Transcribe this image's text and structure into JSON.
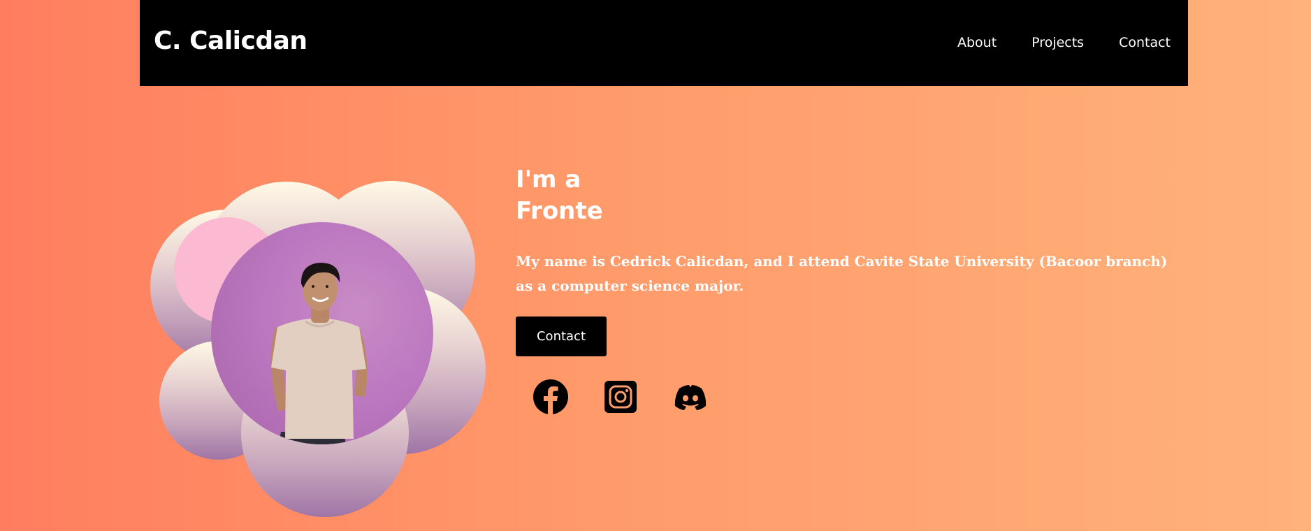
{
  "header": {
    "brand": "C. Calicdan",
    "nav": {
      "about": "About",
      "projects": "Projects",
      "contact": "Contact"
    }
  },
  "hero": {
    "heading_line1": "I'm a",
    "heading_line2": "Fronte",
    "description": "My name is Cedrick Calicdan, and I attend Cavite State University (Bacoor branch) as a computer science major.",
    "contact_button": "Contact"
  },
  "social": [
    {
      "icon": "facebook-icon"
    },
    {
      "icon": "instagram-icon"
    },
    {
      "icon": "discord-icon"
    }
  ],
  "colors": {
    "background_start": "#ff7e5f",
    "background_end": "#ffb27a",
    "navbar": "#000000",
    "photo_backdrop": "#bc78c0",
    "accent_pink": "#fbb9d2"
  }
}
